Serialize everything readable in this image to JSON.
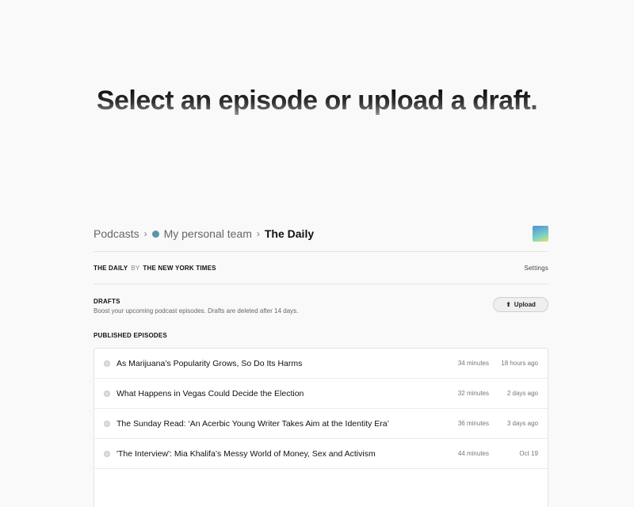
{
  "hero": {
    "title": "Select an episode or upload a draft."
  },
  "breadcrumb": {
    "items": [
      {
        "label": "Podcasts"
      },
      {
        "label": "My personal team"
      },
      {
        "label": "The Daily"
      }
    ],
    "separator": "›",
    "team_color": "#5b93aa"
  },
  "show": {
    "name": "THE DAILY",
    "by_word": "BY",
    "publisher": "THE NEW YORK TIMES",
    "settings_label": "Settings"
  },
  "drafts": {
    "title": "DRAFTS",
    "description": "Boost your upcoming podcast episodes. Drafts are deleted after 14 days.",
    "upload_label": "Upload",
    "upload_icon": "upload-icon"
  },
  "published": {
    "title": "PUBLISHED EPISODES",
    "episodes": [
      {
        "title": "As Marijuana’s Popularity Grows, So Do Its Harms",
        "duration": "34 minutes",
        "date": "18 hours ago"
      },
      {
        "title": "What Happens in Vegas Could Decide the Election",
        "duration": "32 minutes",
        "date": "2 days ago"
      },
      {
        "title": "The Sunday Read: ‘An Acerbic Young Writer Takes Aim at the Identity Era’",
        "duration": "36 minutes",
        "date": "3 days ago"
      },
      {
        "title": "'The Interview': Mia Khalifa’s Messy World of Money, Sex and Activism",
        "duration": "44 minutes",
        "date": "Oct 19"
      }
    ]
  }
}
